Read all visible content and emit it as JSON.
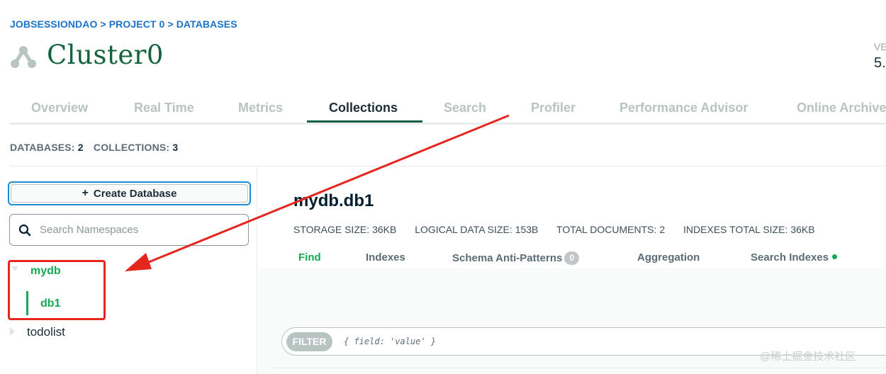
{
  "breadcrumb": {
    "org": "JOBSESSIONDAO",
    "sep1": ">",
    "project": "PROJECT 0",
    "sep2": ">",
    "section": "DATABASES"
  },
  "cluster": {
    "name": "Cluster0",
    "version_label": "VE",
    "version_value": "5."
  },
  "tabs": [
    {
      "label": "Overview",
      "active": false
    },
    {
      "label": "Real Time",
      "active": false
    },
    {
      "label": "Metrics",
      "active": false
    },
    {
      "label": "Collections",
      "active": true
    },
    {
      "label": "Search",
      "active": false
    },
    {
      "label": "Profiler",
      "active": false
    },
    {
      "label": "Performance Advisor",
      "active": false
    },
    {
      "label": "Online Archive",
      "active": false
    }
  ],
  "counts": {
    "databases_label": "DATABASES:",
    "databases_value": "2",
    "collections_label": "COLLECTIONS:",
    "collections_value": "3"
  },
  "sidebar": {
    "create_button": {
      "icon": "plus-icon",
      "label": "Create Database"
    },
    "search": {
      "icon": "search-icon",
      "placeholder": "Search Namespaces"
    },
    "databases": [
      {
        "name": "mydb",
        "expanded": true,
        "collections": [
          "db1"
        ]
      },
      {
        "name": "todolist",
        "expanded": false,
        "collections": []
      }
    ]
  },
  "namespace": {
    "title": "mydb.db1",
    "stats": [
      {
        "label": "STORAGE SIZE:",
        "value": "36KB"
      },
      {
        "label": "LOGICAL DATA SIZE:",
        "value": "153B"
      },
      {
        "label": "TOTAL DOCUMENTS:",
        "value": "2"
      },
      {
        "label": "INDEXES TOTAL SIZE:",
        "value": "36KB"
      }
    ],
    "subtabs": [
      {
        "label": "Find",
        "active": true
      },
      {
        "label": "Indexes",
        "active": false
      },
      {
        "label": "Schema Anti-Patterns",
        "active": false,
        "badge": "0"
      },
      {
        "label": "Aggregation",
        "active": false
      },
      {
        "label": "Search Indexes",
        "active": false,
        "dot": true
      }
    ]
  },
  "query": {
    "filter_label": "FILTER",
    "filter_placeholder": "{ field: 'value' }"
  },
  "watermark": "@稀土掘金技术社区",
  "colors": {
    "brand_green": "#13aa52",
    "title_green": "#12633f",
    "breadcrumb_blue": "#1a73c7",
    "annotation_red": "#e5261f"
  }
}
